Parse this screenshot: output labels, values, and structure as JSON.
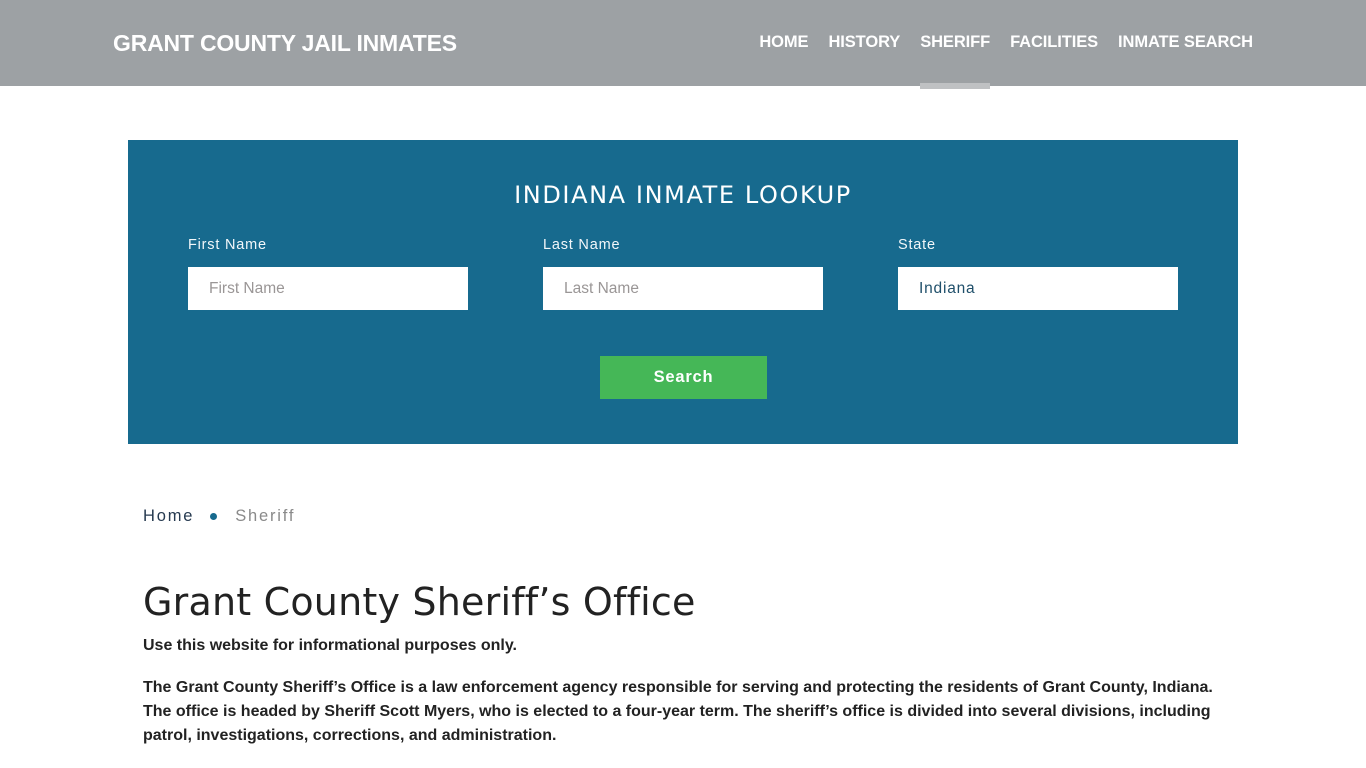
{
  "header": {
    "brand": "GRANT COUNTY JAIL INMATES",
    "nav": [
      {
        "label": "HOME",
        "active": false
      },
      {
        "label": "HISTORY",
        "active": false
      },
      {
        "label": "SHERIFF",
        "active": true
      },
      {
        "label": "FACILITIES",
        "active": false
      },
      {
        "label": "INMATE SEARCH",
        "active": false
      }
    ]
  },
  "lookup": {
    "title": "INDIANA INMATE LOOKUP",
    "first_name": {
      "label": "First Name",
      "placeholder": "First Name",
      "value": ""
    },
    "last_name": {
      "label": "Last Name",
      "placeholder": "Last Name",
      "value": ""
    },
    "state": {
      "label": "State",
      "value": "Indiana"
    },
    "search_label": "Search",
    "colors": {
      "panel": "#176a8e",
      "button": "#45b757"
    }
  },
  "breadcrumb": {
    "home": "Home",
    "current": "Sheriff"
  },
  "content": {
    "title": "Grant County Sheriff’s Office",
    "note": "Use this website for informational purposes only.",
    "paragraph": "The Grant County Sheriff’s Office is a law enforcement agency responsible for serving and protecting the residents of Grant County, Indiana. The office is headed by Sheriff Scott Myers, who is elected to a four-year term. The sheriff’s office is divided into several divisions, including patrol, investigations, corrections, and administration."
  }
}
